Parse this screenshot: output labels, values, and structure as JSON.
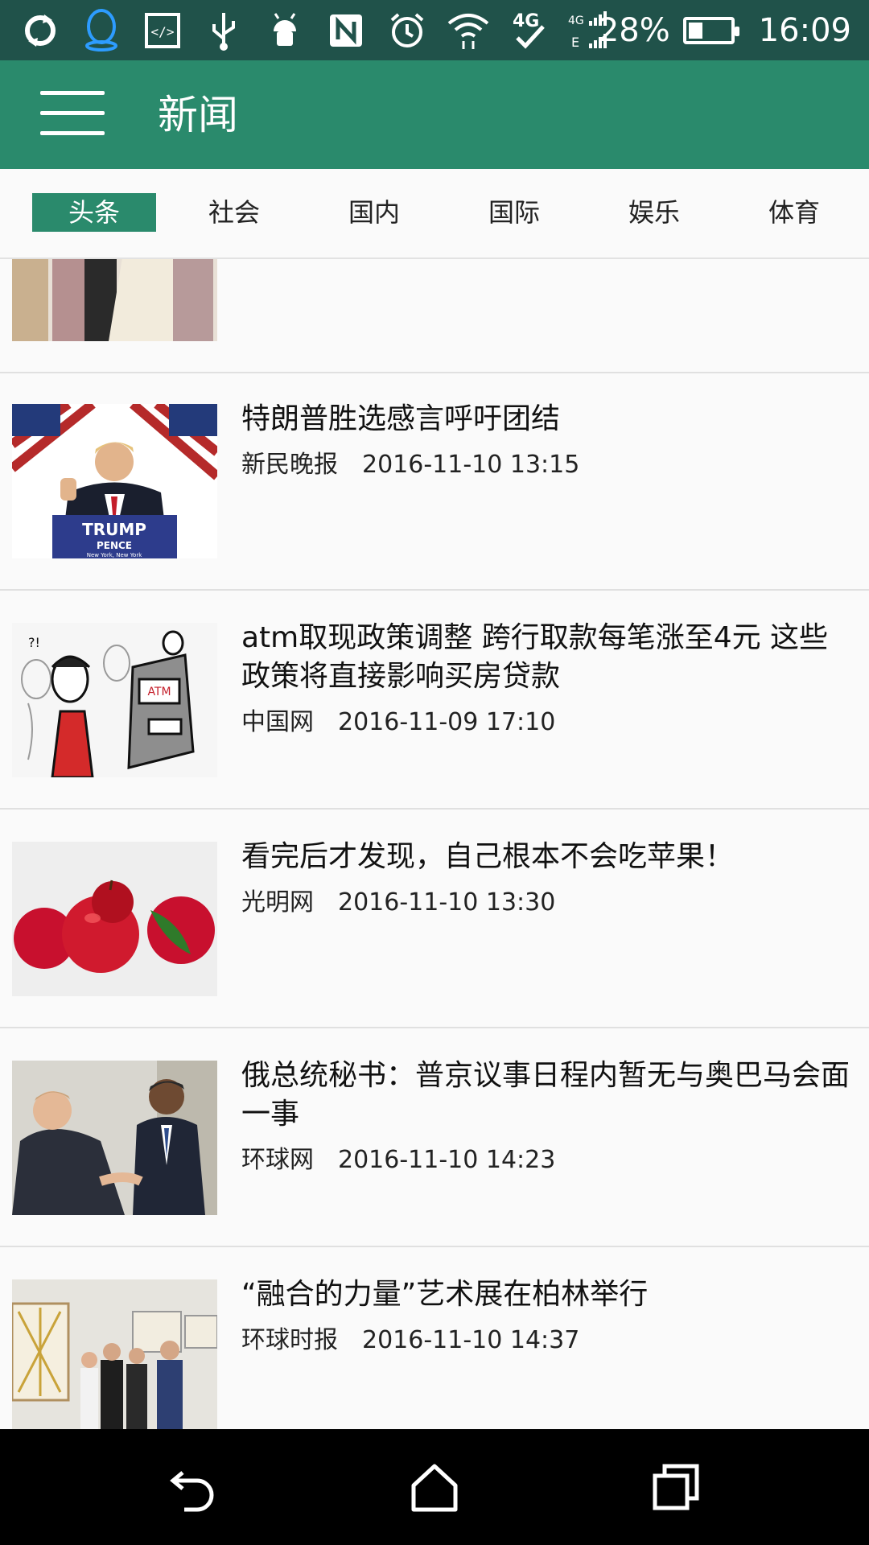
{
  "status_bar": {
    "battery": "28%",
    "time": "16:09",
    "icons": [
      "sync-icon",
      "qq-icon",
      "code-icon",
      "usb-icon",
      "android-icon",
      "nfc-icon",
      "alarm-icon",
      "wifi-icon",
      "4g-icon",
      "signal-icon",
      "battery-icon"
    ]
  },
  "app_bar": {
    "title": "新闻"
  },
  "tabs": [
    {
      "label": "头条",
      "active": true
    },
    {
      "label": "社会"
    },
    {
      "label": "国内"
    },
    {
      "label": "国际"
    },
    {
      "label": "娱乐"
    },
    {
      "label": "体育"
    }
  ],
  "news": [
    {
      "title": "",
      "source": "",
      "time": ""
    },
    {
      "title": "特朗普胜选感言呼吁团结",
      "source": "新民晚报",
      "time": "2016-11-10 13:15"
    },
    {
      "title": "atm取现政策调整 跨行取款每笔涨至4元 这些政策将直接影响买房贷款",
      "source": "中国网",
      "time": "2016-11-09 17:10"
    },
    {
      "title": "看完后才发现，自己根本不会吃苹果！",
      "source": "光明网",
      "time": "2016-11-10 13:30"
    },
    {
      "title": "俄总统秘书：普京议事日程内暂无与奥巴马会面一事",
      "source": "环球网",
      "time": "2016-11-10 14:23"
    },
    {
      "title": "“融合的力量”艺术展在柏林举行",
      "source": "环球时报",
      "time": "2016-11-10 14:37"
    }
  ],
  "thumb_text": {
    "podium": "TRUMP",
    "podium2": "PENCE",
    "podium3": "New York, New York",
    "atm": "ATM"
  },
  "nav": {
    "back": "back-icon",
    "home": "home-icon",
    "recents": "recents-icon"
  },
  "colors": {
    "primary": "#2a8a6c",
    "status_bar": "#20524a"
  }
}
